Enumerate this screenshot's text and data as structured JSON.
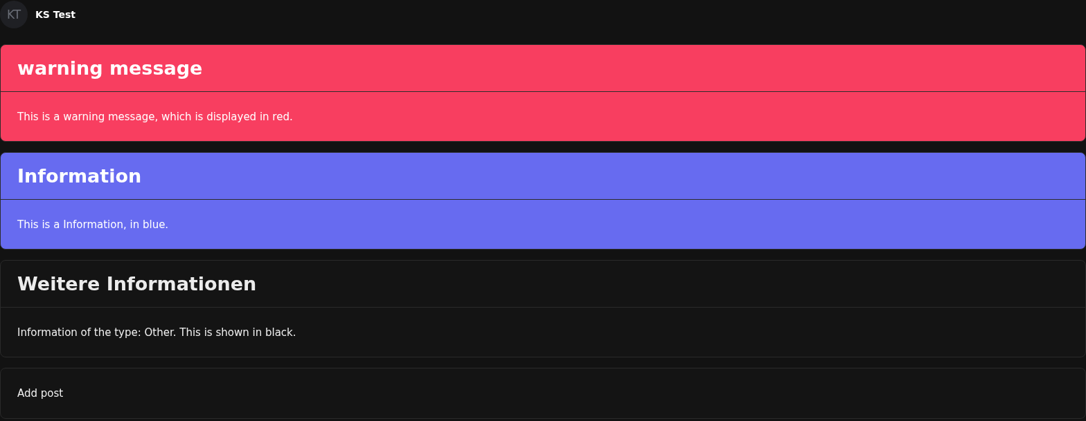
{
  "header": {
    "avatar_initials": "KT",
    "name": "KS Test"
  },
  "messages": [
    {
      "kind": "warning",
      "title": "warning message",
      "text": "This is a warning message, which is displayed in red."
    },
    {
      "kind": "info",
      "title": "Information",
      "text": "This is a Information, in blue."
    },
    {
      "kind": "other",
      "title": "Weitere Informationen",
      "text": "Information of the type: Other. This is shown in black."
    }
  ],
  "add_post": {
    "label": "Add post"
  }
}
